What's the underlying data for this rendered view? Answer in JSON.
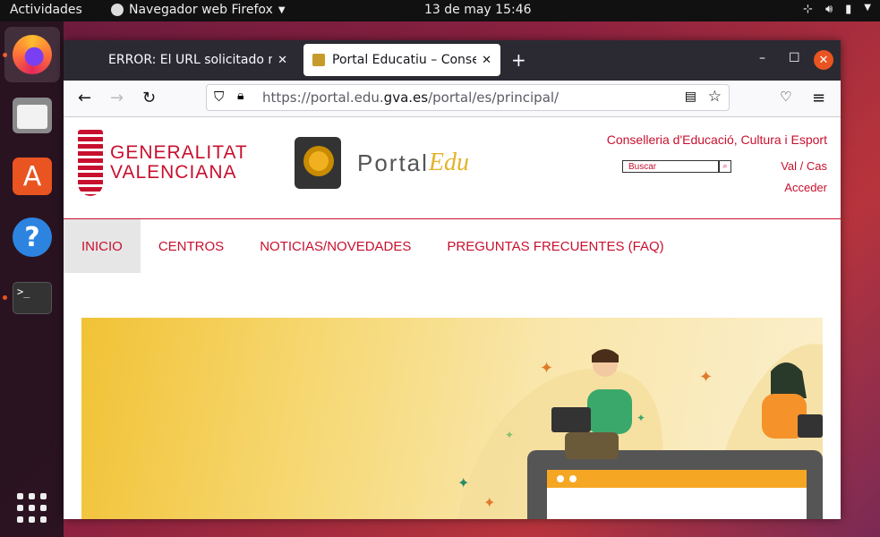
{
  "topbar": {
    "activities": "Actividades",
    "app_name": "Navegador web Firefox",
    "clock": "13 de may  15:46"
  },
  "dock": {
    "items": [
      "firefox-icon",
      "files-icon",
      "software-store-icon",
      "help-icon",
      "terminal-icon",
      "show-apps-icon"
    ]
  },
  "browser": {
    "tabs": [
      {
        "label": "ERROR: El URL solicitado no"
      },
      {
        "label": "Portal Educatiu – Conselleria"
      }
    ],
    "url_prefix": "https://portal.edu.",
    "url_domain": "gva.es",
    "url_path": "/portal/es/principal/"
  },
  "page": {
    "gva_line1": "GENERALITAT",
    "gva_line2": "VALENCIANA",
    "portal_word": "Portal",
    "edu_word": "Edu",
    "conselleria": "Conselleria d'Educació, Cultura i Esport",
    "search_placeholder": "Buscar",
    "lang": "Val / Cas",
    "acceder": "Acceder",
    "menu": [
      "INICIO",
      "CENTROS",
      "NOTICIAS/NOVEDADES",
      "PREGUNTAS FRECUENTES (FAQ)"
    ]
  },
  "colors": {
    "accent": "#c8102e",
    "edu_gold": "#e3b32b",
    "ubuntu_orange": "#e95420"
  }
}
